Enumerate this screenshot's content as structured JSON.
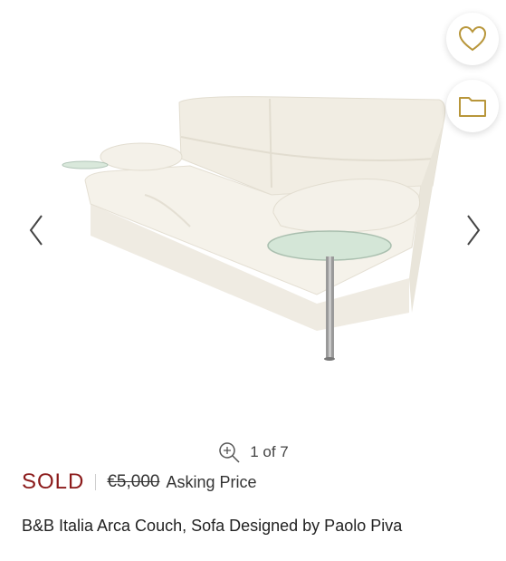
{
  "gallery": {
    "image_alt": "B&B Italia Arca Couch, Sofa Designed by Paolo Piva",
    "counter": "1 of 7",
    "prev_icon": "chevron-left-icon",
    "next_icon": "chevron-right-icon",
    "zoom_icon": "zoom-in-icon"
  },
  "actions": {
    "favorite_icon": "heart-outline-icon",
    "save_icon": "folder-icon",
    "accent_color": "#b8963a"
  },
  "listing": {
    "status": "SOLD",
    "status_color": "#8b1a1a",
    "price": "€5,000",
    "price_label": "Asking Price",
    "title": "B&B Italia Arca Couch, Sofa Designed by Paolo Piva"
  }
}
